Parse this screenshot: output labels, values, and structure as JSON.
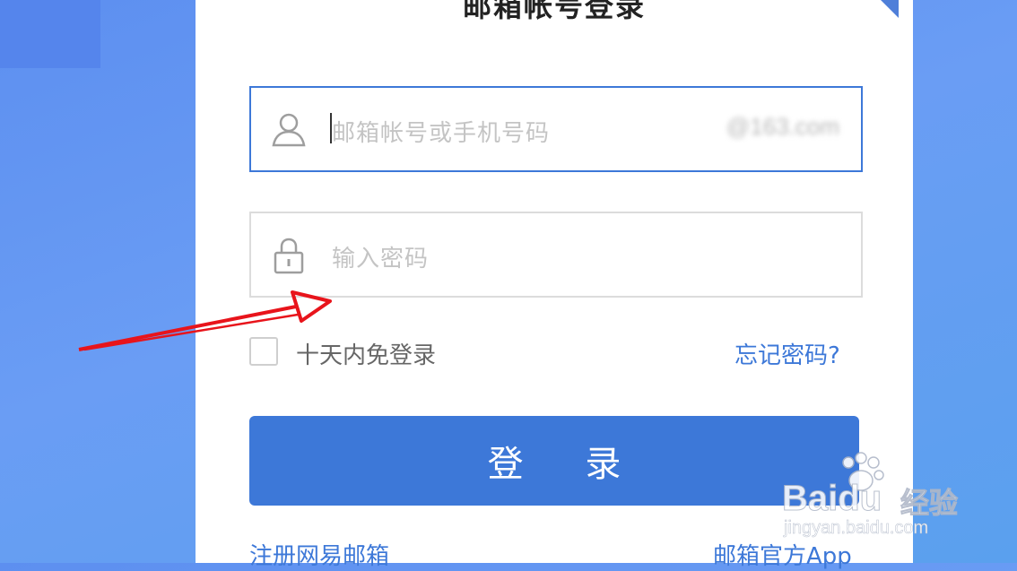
{
  "login": {
    "title": "邮箱帐号登录",
    "account": {
      "placeholder": "邮箱帐号或手机号码",
      "domain_suffix": "@163.com"
    },
    "password": {
      "placeholder": "输入密码"
    },
    "remember_label": "十天内免登录",
    "forgot_label": "忘记密码?",
    "submit_label": "登 录",
    "register_label": "注册网易邮箱",
    "app_label": "邮箱官方App"
  },
  "watermark": {
    "logo": "Baidu",
    "suffix": "经验",
    "url": "jingyan.baidu.com"
  },
  "colors": {
    "accent": "#3d78d8",
    "background": "#6a9df4",
    "annotation": "#e8141b"
  },
  "icons": {
    "account": "user-icon",
    "password": "lock-icon",
    "annotation": "red-arrow-icon"
  }
}
